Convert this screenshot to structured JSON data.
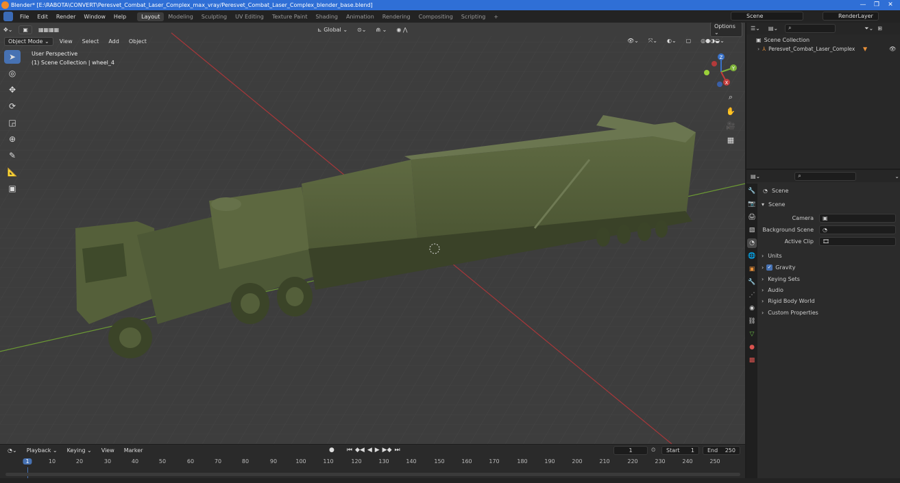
{
  "title_bar": {
    "text": "Blender* [E:\\RABOTA\\CONVERT\\Peresvet_Combat_Laser_Complex_max_vray/Peresvet_Combat_Laser_Complex_blender_base.blend]"
  },
  "menu": [
    "File",
    "Edit",
    "Render",
    "Window",
    "Help"
  ],
  "workspaces": [
    "Layout",
    "Modeling",
    "Sculpting",
    "UV Editing",
    "Texture Paint",
    "Shading",
    "Animation",
    "Rendering",
    "Compositing",
    "Scripting",
    "+"
  ],
  "scene_selector": "Scene",
  "render_layer_selector": "RenderLayer",
  "viewport": {
    "mode": "Object Mode",
    "menus": [
      "View",
      "Select",
      "Add",
      "Object"
    ],
    "transform_orientation": "Global",
    "options_label": "Options",
    "overlay_line1": "User Perspective",
    "overlay_line2": "(1) Scene Collection | wheel_4"
  },
  "gizmo": {
    "x": "X",
    "y": "Y",
    "z": "Z"
  },
  "outliner": {
    "root": "Scene Collection",
    "item": "Peresvet_Combat_Laser_Complex"
  },
  "properties": {
    "header": "Scene",
    "section": "Scene",
    "fields": [
      {
        "label": "Camera"
      },
      {
        "label": "Background Scene"
      },
      {
        "label": "Active Clip"
      }
    ],
    "panels": [
      "Units",
      "Gravity",
      "Keying Sets",
      "Audio",
      "Rigid Body World",
      "Custom Properties"
    ]
  },
  "timeline": {
    "menus": [
      "Playback",
      "Keying",
      "View",
      "Marker"
    ],
    "current_frame": "1",
    "start_label": "Start",
    "start": "1",
    "end_label": "End",
    "end": "250",
    "ruler": [
      "1",
      "10",
      "20",
      "30",
      "40",
      "50",
      "60",
      "70",
      "80",
      "90",
      "100",
      "110",
      "120",
      "130",
      "140",
      "150",
      "160",
      "170",
      "180",
      "190",
      "200",
      "210",
      "220",
      "230",
      "240",
      "250"
    ]
  },
  "colors": {
    "accent": "#4772b3",
    "viewport_bg": "#3d3d3d",
    "axis_x": "#c33c3c",
    "axis_y": "#7fb33a",
    "vehicle": "#56613b"
  }
}
